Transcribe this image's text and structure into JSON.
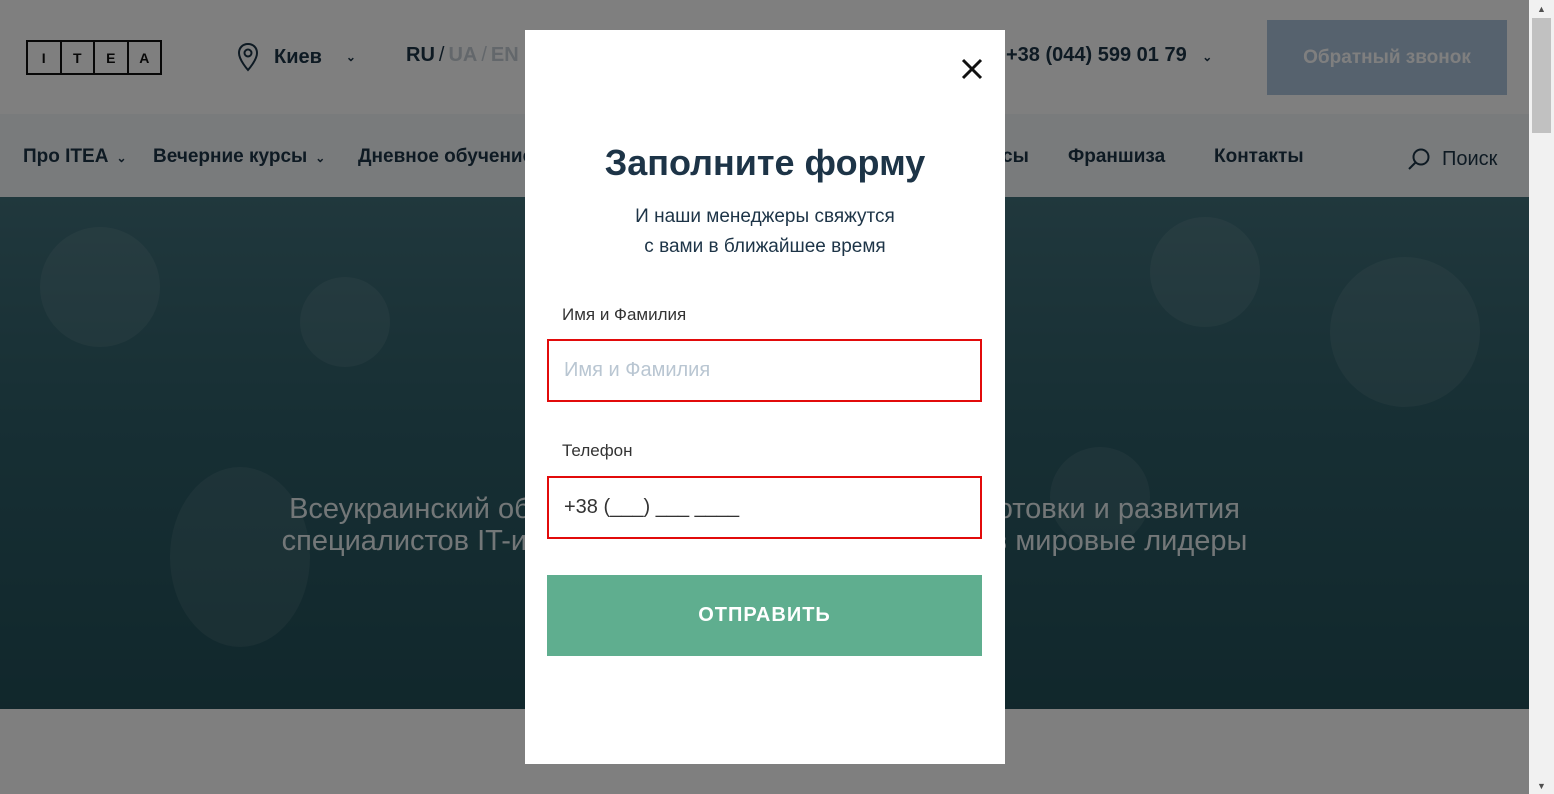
{
  "header": {
    "logo_letters": [
      "I",
      "T",
      "E",
      "A"
    ],
    "city": "Киев",
    "languages": {
      "active": "RU",
      "others": [
        "UA",
        "EN"
      ]
    },
    "phone": "+38 (044) 599 01 79",
    "callback_label": "Обратный звонок"
  },
  "nav": {
    "items": [
      {
        "label": "Про ITEA"
      },
      {
        "label": "Вечерние курсы"
      },
      {
        "label": "Дневное обучение"
      },
      {
        "label": "сы"
      },
      {
        "label": "Франшиза"
      },
      {
        "label": "Контакты"
      }
    ],
    "search_label": "Поиск"
  },
  "hero": {
    "line1": "Всеукраинский образо                                             одготовки и развития",
    "line2": "специалистов IT-инду                                                 у в мировые лидеры"
  },
  "modal": {
    "title": "Заполните форму",
    "subtitle_line1": "И наши менеджеры свяжутся",
    "subtitle_line2": "с вами в ближайшее время",
    "name_label": "Имя и Фамилия",
    "name_placeholder": "Имя и Фамилия",
    "name_value": "",
    "phone_label": "Телефон",
    "phone_value": "+38 (___) ___ ____",
    "submit_label": "ОТПРАВИТЬ"
  },
  "colors": {
    "primary_text": "#1d3447",
    "error_border": "#e20b0b",
    "submit_bg": "#5fae8f",
    "callback_bg": "#adc4dd"
  }
}
